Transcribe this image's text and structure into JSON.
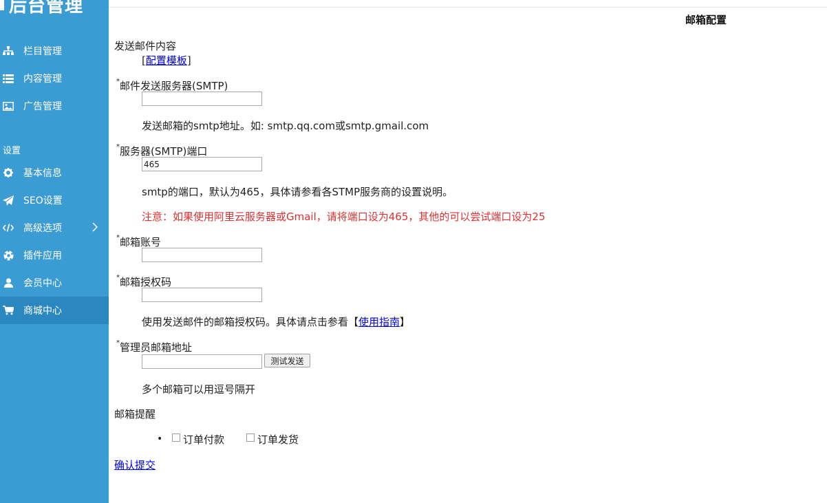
{
  "sidebar": {
    "logo": "后台管理",
    "items": [
      {
        "label": "栏目管理",
        "icon": "sitemap-icon"
      },
      {
        "label": "内容管理",
        "icon": "list-icon"
      },
      {
        "label": "广告管理",
        "icon": "image-icon"
      }
    ],
    "section_label": "设置",
    "settings_items": [
      {
        "label": "基本信息",
        "icon": "gear-icon"
      },
      {
        "label": "SEO设置",
        "icon": "paper-plane-icon"
      },
      {
        "label": "高级选项",
        "icon": "code-icon"
      },
      {
        "label": "插件应用",
        "icon": "soccer-ball-icon"
      },
      {
        "label": "会员中心",
        "icon": "user-icon"
      },
      {
        "label": "商城中心",
        "icon": "cart-icon"
      }
    ]
  },
  "page_title": "邮箱配置",
  "form": {
    "send_content_label": "发送邮件内容",
    "template_link_open": "[",
    "template_link": "配置模板",
    "template_link_close": "]",
    "smtp_server_label": "邮件发送服务器(SMTP)",
    "smtp_server_value": "",
    "smtp_server_hint": "发送邮箱的smtp地址。如: smtp.qq.com或smtp.gmail.com",
    "smtp_port_label": "服务器(SMTP)端口",
    "smtp_port_value": "465",
    "smtp_port_hint": "smtp的端口，默认为465，具体请参看各STMP服务商的设置说明。",
    "smtp_port_warning": "注意：如果使用阿里云服务器或Gmail，请将端口设为465，其他的可以尝试端口设为25",
    "account_label": "邮箱账号",
    "account_value": "",
    "auth_code_label": "邮箱授权码",
    "auth_code_value": "",
    "auth_code_hint_pre": "使用发送邮件的邮箱授权码。具体请点击参看【",
    "auth_code_hint_link": "使用指南",
    "auth_code_hint_post": "】",
    "admin_email_label": "管理员邮箱地址",
    "admin_email_value": "",
    "test_send_button": "测试发送",
    "admin_email_hint": "多个邮箱可以用逗号隔开",
    "reminder_label": "邮箱提醒",
    "reminder_options": [
      "订单付款",
      "订单发货"
    ],
    "required_mark": "*",
    "submit_link": "确认提交"
  }
}
